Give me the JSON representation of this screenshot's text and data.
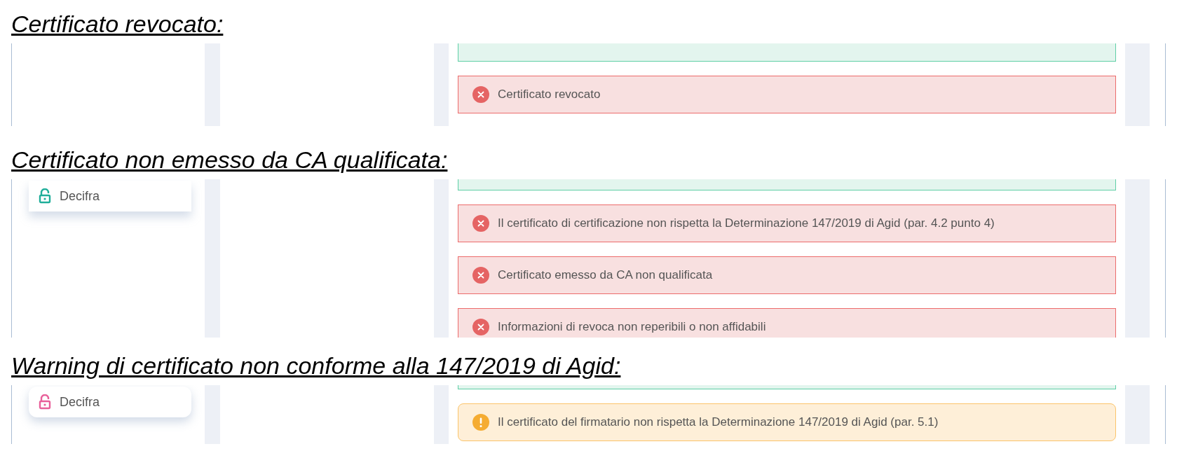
{
  "sections": [
    {
      "title": "Certificato revocato:",
      "alerts": [
        {
          "kind": "success"
        },
        {
          "kind": "error",
          "text": "Certificato revocato"
        }
      ]
    },
    {
      "title": "Certificato non emesso da CA qualificata:",
      "decifra": {
        "label": "Decifra",
        "kind": "flat",
        "color": "#1fae9a"
      },
      "alerts": [
        {
          "kind": "success"
        },
        {
          "kind": "error",
          "text": "Il certificato di certificazione non rispetta la Determinazione 147/2019 di Agid (par. 4.2 punto 4)"
        },
        {
          "kind": "error",
          "text": "Certificato emesso da CA non qualificata"
        },
        {
          "kind": "error",
          "text": "Informazioni di revoca non reperibili o non affidabili"
        }
      ]
    },
    {
      "title": "Warning di certificato non conforme alla 147/2019 di Agid:",
      "decifra": {
        "label": "Decifra",
        "kind": "rounded",
        "color": "#e8609a"
      },
      "alerts": [
        {
          "kind": "success"
        },
        {
          "kind": "warning",
          "text": "Il certificato del firmatario non rispetta la Determinazione 147/2019 di Agid (par. 5.1)"
        }
      ]
    }
  ]
}
